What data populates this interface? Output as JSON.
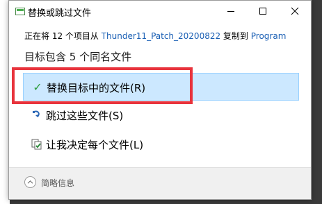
{
  "window": {
    "title": "替换或跳过文件",
    "icon": "file-copy-icon"
  },
  "status": {
    "prefix": "正在将 12 个项目从 ",
    "source": "Thunder11_Patch_20200822",
    "middle": " 复制到 ",
    "destination": "Program"
  },
  "heading": "目标包含 5 个同名文件",
  "options": [
    {
      "label": "替换目标中的文件(R)",
      "icon": "checkmark-icon",
      "selected": true
    },
    {
      "label": "跳过这些文件(S)",
      "icon": "skip-arrow-icon",
      "selected": false
    },
    {
      "label": "让我决定每个文件(L)",
      "icon": "decide-files-icon",
      "selected": false
    }
  ],
  "footer": {
    "label": "简略信息",
    "icon": "chevron-up-icon"
  },
  "colors": {
    "selected_bg": "#cce8ff",
    "selected_border": "#99d1ff",
    "highlight_box": "#e8333c",
    "link_text": "#1a5fb4"
  }
}
